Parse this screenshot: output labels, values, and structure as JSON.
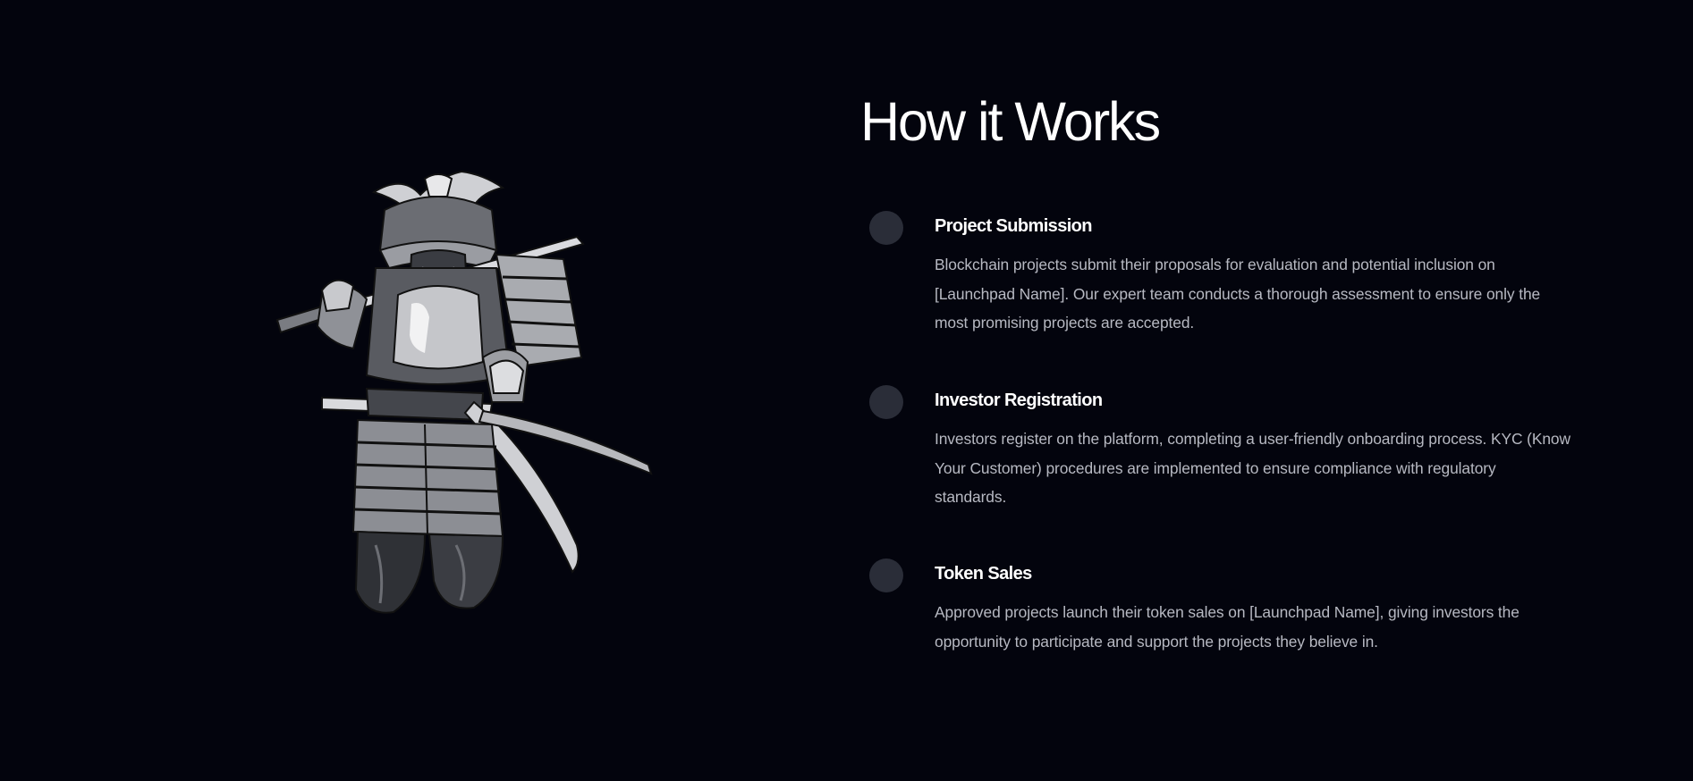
{
  "section": {
    "title": "How it Works"
  },
  "illustration": {
    "icon": "samurai-warrior-illustration"
  },
  "steps": [
    {
      "title": "Project Submission",
      "description": "Blockchain projects submit their proposals for evaluation and potential inclusion on [Launchpad Name]. Our expert team conducts a thorough assessment to ensure only the most promising projects are accepted."
    },
    {
      "title": "Investor Registration",
      "description": "Investors register on the platform, completing a user-friendly onboarding process. KYC (Know Your Customer) procedures are implemented to ensure compliance with regulatory standards."
    },
    {
      "title": "Token Sales",
      "description": "Approved projects launch their token sales on [Launchpad Name], giving investors the opportunity to participate and support the projects they believe in."
    }
  ],
  "colors": {
    "background": "#03040d",
    "heading": "#ffffff",
    "body_text": "#b7b9c2",
    "step_marker": "#2a2d38"
  }
}
